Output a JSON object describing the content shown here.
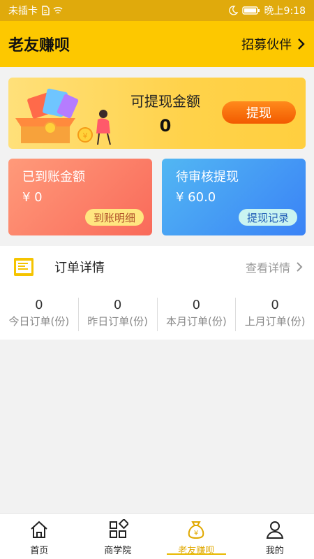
{
  "status_bar": {
    "carrier": "未插卡",
    "time": "晚上9:18"
  },
  "header": {
    "title": "老友赚呗",
    "recruit_label": "招募伙伴"
  },
  "withdraw_panel": {
    "label": "可提现金额",
    "amount": "0",
    "button_label": "提现"
  },
  "cards": {
    "received": {
      "title": "已到账金额",
      "value": "¥ 0",
      "button_label": "到账明细"
    },
    "pending": {
      "title": "待审核提现",
      "value": "¥ 60.0",
      "button_label": "提现记录"
    }
  },
  "orders": {
    "title": "订单详情",
    "more_label": "查看详情",
    "stats": [
      {
        "value": "0",
        "label": "今日订单(份)"
      },
      {
        "value": "0",
        "label": "昨日订单(份)"
      },
      {
        "value": "0",
        "label": "本月订单(份)"
      },
      {
        "value": "0",
        "label": "上月订单(份)"
      }
    ]
  },
  "tabs": [
    {
      "label": "首页",
      "icon": "home-icon"
    },
    {
      "label": "商学院",
      "icon": "grid-shapes-icon"
    },
    {
      "label": "老友赚呗",
      "icon": "money-bag-icon",
      "active": true
    },
    {
      "label": "我的",
      "icon": "person-icon"
    }
  ],
  "colors": {
    "brand_yellow": "#fdc800",
    "orange_button": "#f25a00",
    "active_tab": "#e0a800"
  }
}
